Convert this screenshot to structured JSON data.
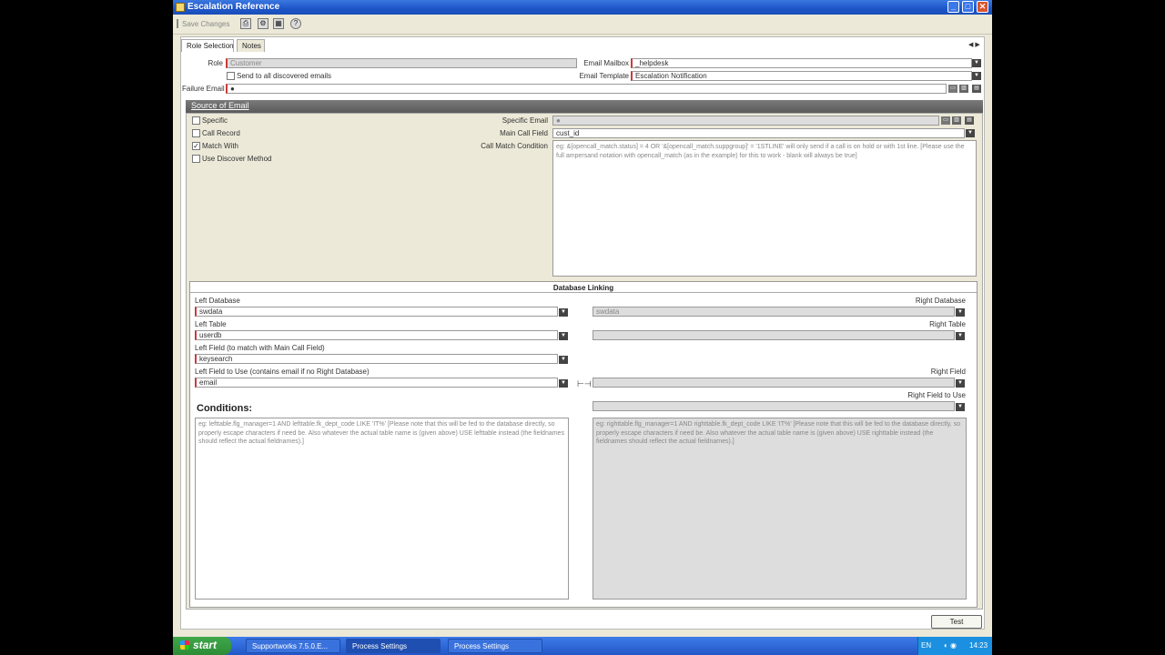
{
  "window": {
    "title": "Escalation Reference",
    "buttons": {
      "minimize": "_",
      "maximize": "□",
      "close": "✕"
    }
  },
  "toolbar": {
    "save_label": "Save Changes",
    "help": "?"
  },
  "tabs": [
    {
      "label": "Role Selection",
      "active": true
    },
    {
      "label": "Notes",
      "active": false
    }
  ],
  "nav": {
    "arrows": "◀ ▶"
  },
  "form": {
    "role_label": "Role",
    "role_value": "Customer",
    "send_all_label": "Send to all discovered emails",
    "email_mailbox_label": "Email Mailbox",
    "email_mailbox_value": "_helpdesk",
    "email_template_label": "Email Template",
    "email_template_value": "Escalation Notification",
    "failure_email_label": "Failure Email"
  },
  "source": {
    "title": "Source of Email",
    "options": [
      {
        "label": "Specific",
        "checked": false
      },
      {
        "label": "Call Record",
        "checked": false
      },
      {
        "label": "Match With",
        "checked": true
      },
      {
        "label": "Use Discover Method",
        "checked": false
      }
    ],
    "specific_email_label": "Specific Email",
    "main_call_field_label": "Main Call Field",
    "main_call_field_value": "cust_id",
    "call_match_label": "Call Match Condition",
    "call_match_placeholder": "eg: &[opencall_match.status] = 4 OR '&[opencall_match.suppgroup]' = '1STLINE' will only send if a call is on hold or with 1st line. [Please use the full ampersand notation with opencall_match (as in the example) for this to work - blank will always be true]"
  },
  "db": {
    "title": "Database Linking",
    "left_db_label": "Left Database",
    "left_db_value": "swdata",
    "left_table_label": "Left Table",
    "left_table_value": "userdb",
    "left_field_label": "Left Field (to match with Main Call Field)",
    "left_field_value": "keysearch",
    "left_use_label": "Left Field to Use (contains email if no Right Database)",
    "left_use_value": "email",
    "right_db_label": "Right Database",
    "right_db_value": "swdata",
    "right_table_label": "Right Table",
    "right_field_label": "Right Field",
    "right_use_label": "Right Field to Use",
    "conditions_label": "Conditions:",
    "left_cond_placeholder": "eg: lefttable.flg_manager=1 AND lefttable.fk_dept_code LIKE 'IT%' [Please note that this will be fed to the database directly, so properly escape characters if need be. Also whatever the actual table name is (given above) USE lefttable instead (the fieldnames should reflect the actual fieldnames).]",
    "right_cond_placeholder": "eg: righttable.flg_manager=1 AND righttable.fk_dept_code LIKE 'IT%' [Please note that this will be fed to the database directly, so properly escape characters if need be. Also whatever the actual table name is (given above) USE righttable instead (the fieldnames should reflect the actual fieldnames).]"
  },
  "test_button": "Test",
  "taskbar": {
    "start": "start",
    "tasks": [
      "Supportworks 7.5.0.E...",
      "Process Settings",
      "Process Settings"
    ],
    "lang": "EN",
    "clock": "14:23"
  }
}
